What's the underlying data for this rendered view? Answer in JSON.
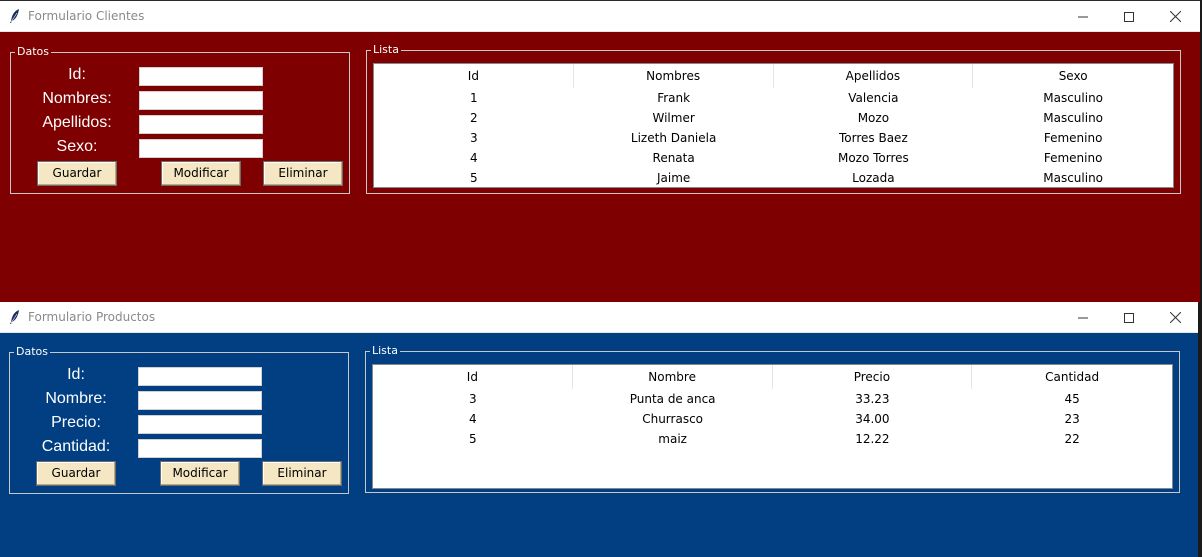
{
  "clientes": {
    "title": "Formulario Clientes",
    "datos_label": "Datos",
    "lista_label": "Lista",
    "fields": [
      {
        "label": "Id:",
        "value": ""
      },
      {
        "label": "Nombres:",
        "value": ""
      },
      {
        "label": "Apellidos:",
        "value": ""
      },
      {
        "label": "Sexo:",
        "value": ""
      }
    ],
    "buttons": {
      "save": "Guardar",
      "modify": "Modificar",
      "delete": "Eliminar"
    },
    "columns": [
      "Id",
      "Nombres",
      "Apellidos",
      "Sexo"
    ],
    "rows": [
      [
        "1",
        "Frank",
        "Valencia",
        "Masculino"
      ],
      [
        "2",
        "Wilmer",
        "Mozo",
        "Masculino"
      ],
      [
        "3",
        "Lizeth Daniela",
        "Torres Baez",
        "Femenino"
      ],
      [
        "4",
        "Renata",
        "Mozo Torres",
        "Femenino"
      ],
      [
        "5",
        "Jaime",
        "Lozada",
        "Masculino"
      ]
    ],
    "background_color": "#7f0000"
  },
  "productos": {
    "title": "Formulario Productos",
    "datos_label": "Datos",
    "lista_label": "Lista",
    "fields": [
      {
        "label": "Id:",
        "value": ""
      },
      {
        "label": "Nombre:",
        "value": ""
      },
      {
        "label": "Precio:",
        "value": ""
      },
      {
        "label": "Cantidad:",
        "value": ""
      }
    ],
    "buttons": {
      "save": "Guardar",
      "modify": "Modificar",
      "delete": "Eliminar"
    },
    "columns": [
      "Id",
      "Nombre",
      "Precio",
      "Cantidad"
    ],
    "rows": [
      [
        "3",
        "Punta de anca",
        "33.23",
        "45"
      ],
      [
        "4",
        "Churrasco",
        "34.00",
        "23"
      ],
      [
        "5",
        "maiz",
        "12.22",
        "22"
      ]
    ],
    "background_color": "#013f82"
  },
  "icons": {
    "app": "feather-icon",
    "minimize": "minimize-icon",
    "maximize": "maximize-icon",
    "close": "close-icon"
  }
}
